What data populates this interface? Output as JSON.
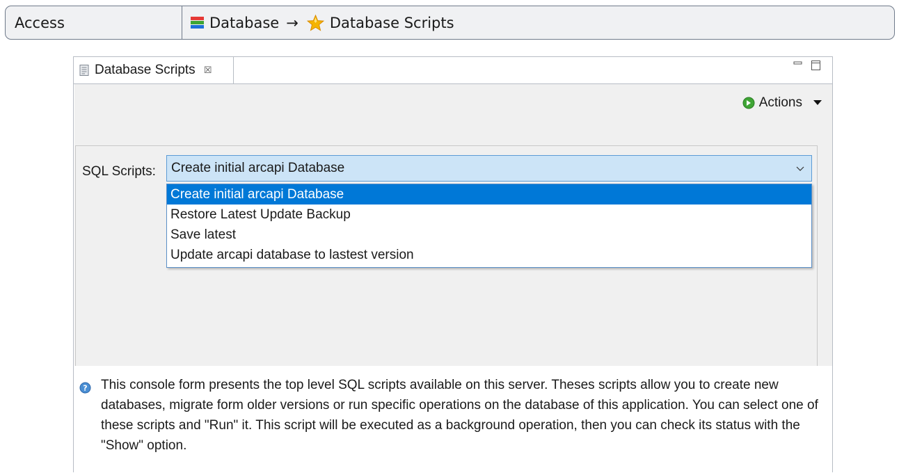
{
  "access": {
    "label": "Access",
    "path_part1": "Database",
    "arrow": "→",
    "path_part2": "Database Scripts"
  },
  "view": {
    "tab_title": "Database Scripts",
    "tab_close": "☒",
    "actions_label": "Actions",
    "sql_scripts_label": "SQL Scripts:",
    "selected_script": "Create initial arcapi Database",
    "dropdown_options": [
      "Create initial arcapi Database",
      "Restore Latest Update Backup",
      "Save latest",
      "Update arcapi database to lastest version"
    ],
    "help_text": "This console form presents the top level SQL scripts available on this server. Theses scripts allow you to create new databases, migrate form older versions or run specific operations on the database of this application. You can select one of these scripts and \"Run\" it. This script will be executed as a background operation, then you can check its status with the \"Show\" option."
  },
  "icons": {
    "database": "database-icon",
    "star": "star-icon",
    "tab": "script-file-icon",
    "actions": "green-arrow-circle-icon",
    "help": "info-icon"
  },
  "colors": {
    "selection": "#0078d7",
    "combo_focus": "#cce4f7",
    "accent_green": "#3fa535",
    "star_gold": "#f5b400"
  }
}
